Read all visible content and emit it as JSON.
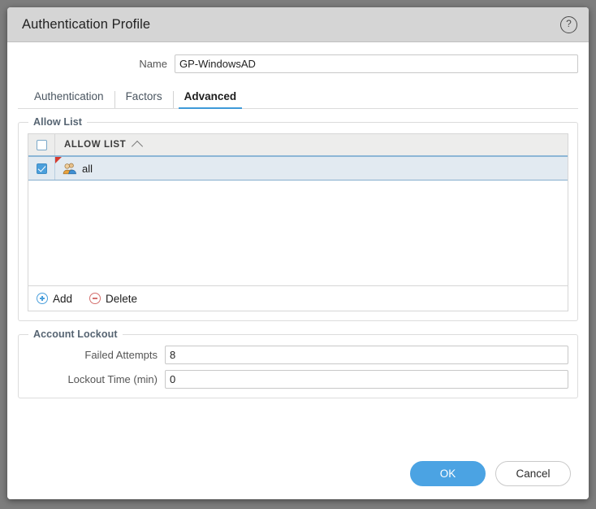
{
  "window": {
    "title": "Authentication Profile",
    "help_icon": "help-circle-icon",
    "help_label": "?"
  },
  "name_field": {
    "label": "Name",
    "value": "GP-WindowsAD",
    "placeholder": ""
  },
  "tabs": [
    {
      "label": "Authentication",
      "active": false
    },
    {
      "label": "Factors",
      "active": false
    },
    {
      "label": "Advanced",
      "active": true
    }
  ],
  "allow_list": {
    "legend": "Allow List",
    "column_header": "ALLOW LIST",
    "sort_direction": "ascending",
    "sort_icon": "chevron-up-icon",
    "header_checkbox_checked": false,
    "rows": [
      {
        "checked": true,
        "icon": "user-group-icon",
        "label": "all",
        "modified": true
      }
    ],
    "toolbar": {
      "add_label": "Add",
      "add_icon": "plus-circle-icon",
      "delete_label": "Delete",
      "delete_icon": "minus-circle-icon"
    }
  },
  "account_lockout": {
    "legend": "Account Lockout",
    "fields": [
      {
        "label": "Failed Attempts",
        "value": "8"
      },
      {
        "label": "Lockout Time (min)",
        "value": "0"
      }
    ]
  },
  "footer": {
    "ok_label": "OK",
    "cancel_label": "Cancel"
  },
  "colors": {
    "accent_blue": "#4ba3e3",
    "tab_underline": "#3e9ad8",
    "row_highlight": "#e2eaf1",
    "legend_text": "#566472",
    "delete_red": "#d4706e",
    "modified_flag": "#d63b2f",
    "titlebar": "#d5d5d5",
    "page_background": "#7d7d7d"
  }
}
